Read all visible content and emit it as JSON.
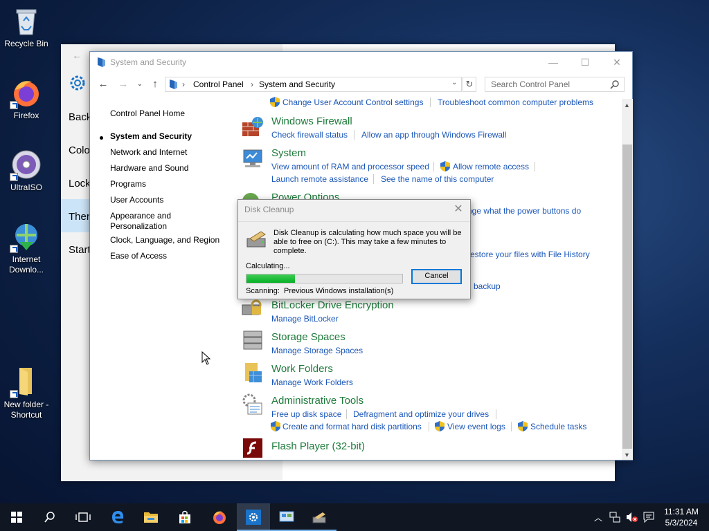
{
  "desktop": {
    "icons": [
      {
        "label": "Recycle Bin"
      },
      {
        "label": "Firefox"
      },
      {
        "label": "UltraISO"
      },
      {
        "label": "Internet Downlo..."
      },
      {
        "label": "New folder - Shortcut"
      }
    ]
  },
  "settings_window": {
    "items": [
      "Back",
      "Colo",
      "Lock",
      "Ther",
      "Start"
    ]
  },
  "control_panel": {
    "title": "System and Security",
    "address": {
      "crumb1": "Control Panel",
      "crumb2": "System and Security"
    },
    "search": {
      "placeholder": "Search Control Panel"
    },
    "left_nav": {
      "home": "Control Panel Home",
      "items": [
        "System and Security",
        "Network and Internet",
        "Hardware and Sound",
        "Programs",
        "User Accounts",
        "Appearance and Personalization",
        "Clock, Language, and Region",
        "Ease of Access"
      ]
    },
    "top_links": [
      "Change User Account Control settings",
      "Troubleshoot common computer problems"
    ],
    "categories": {
      "firewall": {
        "title": "Windows Firewall",
        "links": [
          "Check firewall status",
          "Allow an app through Windows Firewall"
        ]
      },
      "system": {
        "title": "System",
        "links": [
          "View amount of RAM and processor speed",
          "Allow remote access",
          "Launch remote assistance",
          "See the name of this computer"
        ]
      },
      "power": {
        "title": "Power Options",
        "links": [
          "nge what the power buttons do"
        ]
      },
      "file_history": {
        "links": [
          "estore your files with File History"
        ]
      },
      "backup": {
        "links": [
          "backup"
        ]
      },
      "bitlocker": {
        "title": "BitLocker Drive Encryption",
        "links": [
          "Manage BitLocker"
        ]
      },
      "storage": {
        "title": "Storage Spaces",
        "links": [
          "Manage Storage Spaces"
        ]
      },
      "work_folders": {
        "title": "Work Folders",
        "links": [
          "Manage Work Folders"
        ]
      },
      "admin_tools": {
        "title": "Administrative Tools",
        "links": [
          "Free up disk space",
          "Defragment and optimize your drives",
          "Create and format hard disk partitions",
          "View event logs",
          "Schedule tasks"
        ]
      },
      "flash": {
        "title": "Flash Player (32-bit)"
      }
    }
  },
  "disk_cleanup": {
    "title": "Disk Cleanup",
    "message": "Disk Cleanup is calculating how much space you will be able to free on  (C:). This may take a few minutes to complete.",
    "status": "Calculating...",
    "progress": 0.31,
    "cancel_label": "Cancel",
    "scanning_label": "Scanning:",
    "scanning_value": "Previous Windows installation(s)"
  },
  "taskbar": {
    "time": "11:31 AM",
    "date": "5/3/2024"
  },
  "colors": {
    "accent": "#0078d7",
    "link": "#1a56b8",
    "category_title": "#1e7a3a",
    "progress_fill": "#06b025"
  }
}
